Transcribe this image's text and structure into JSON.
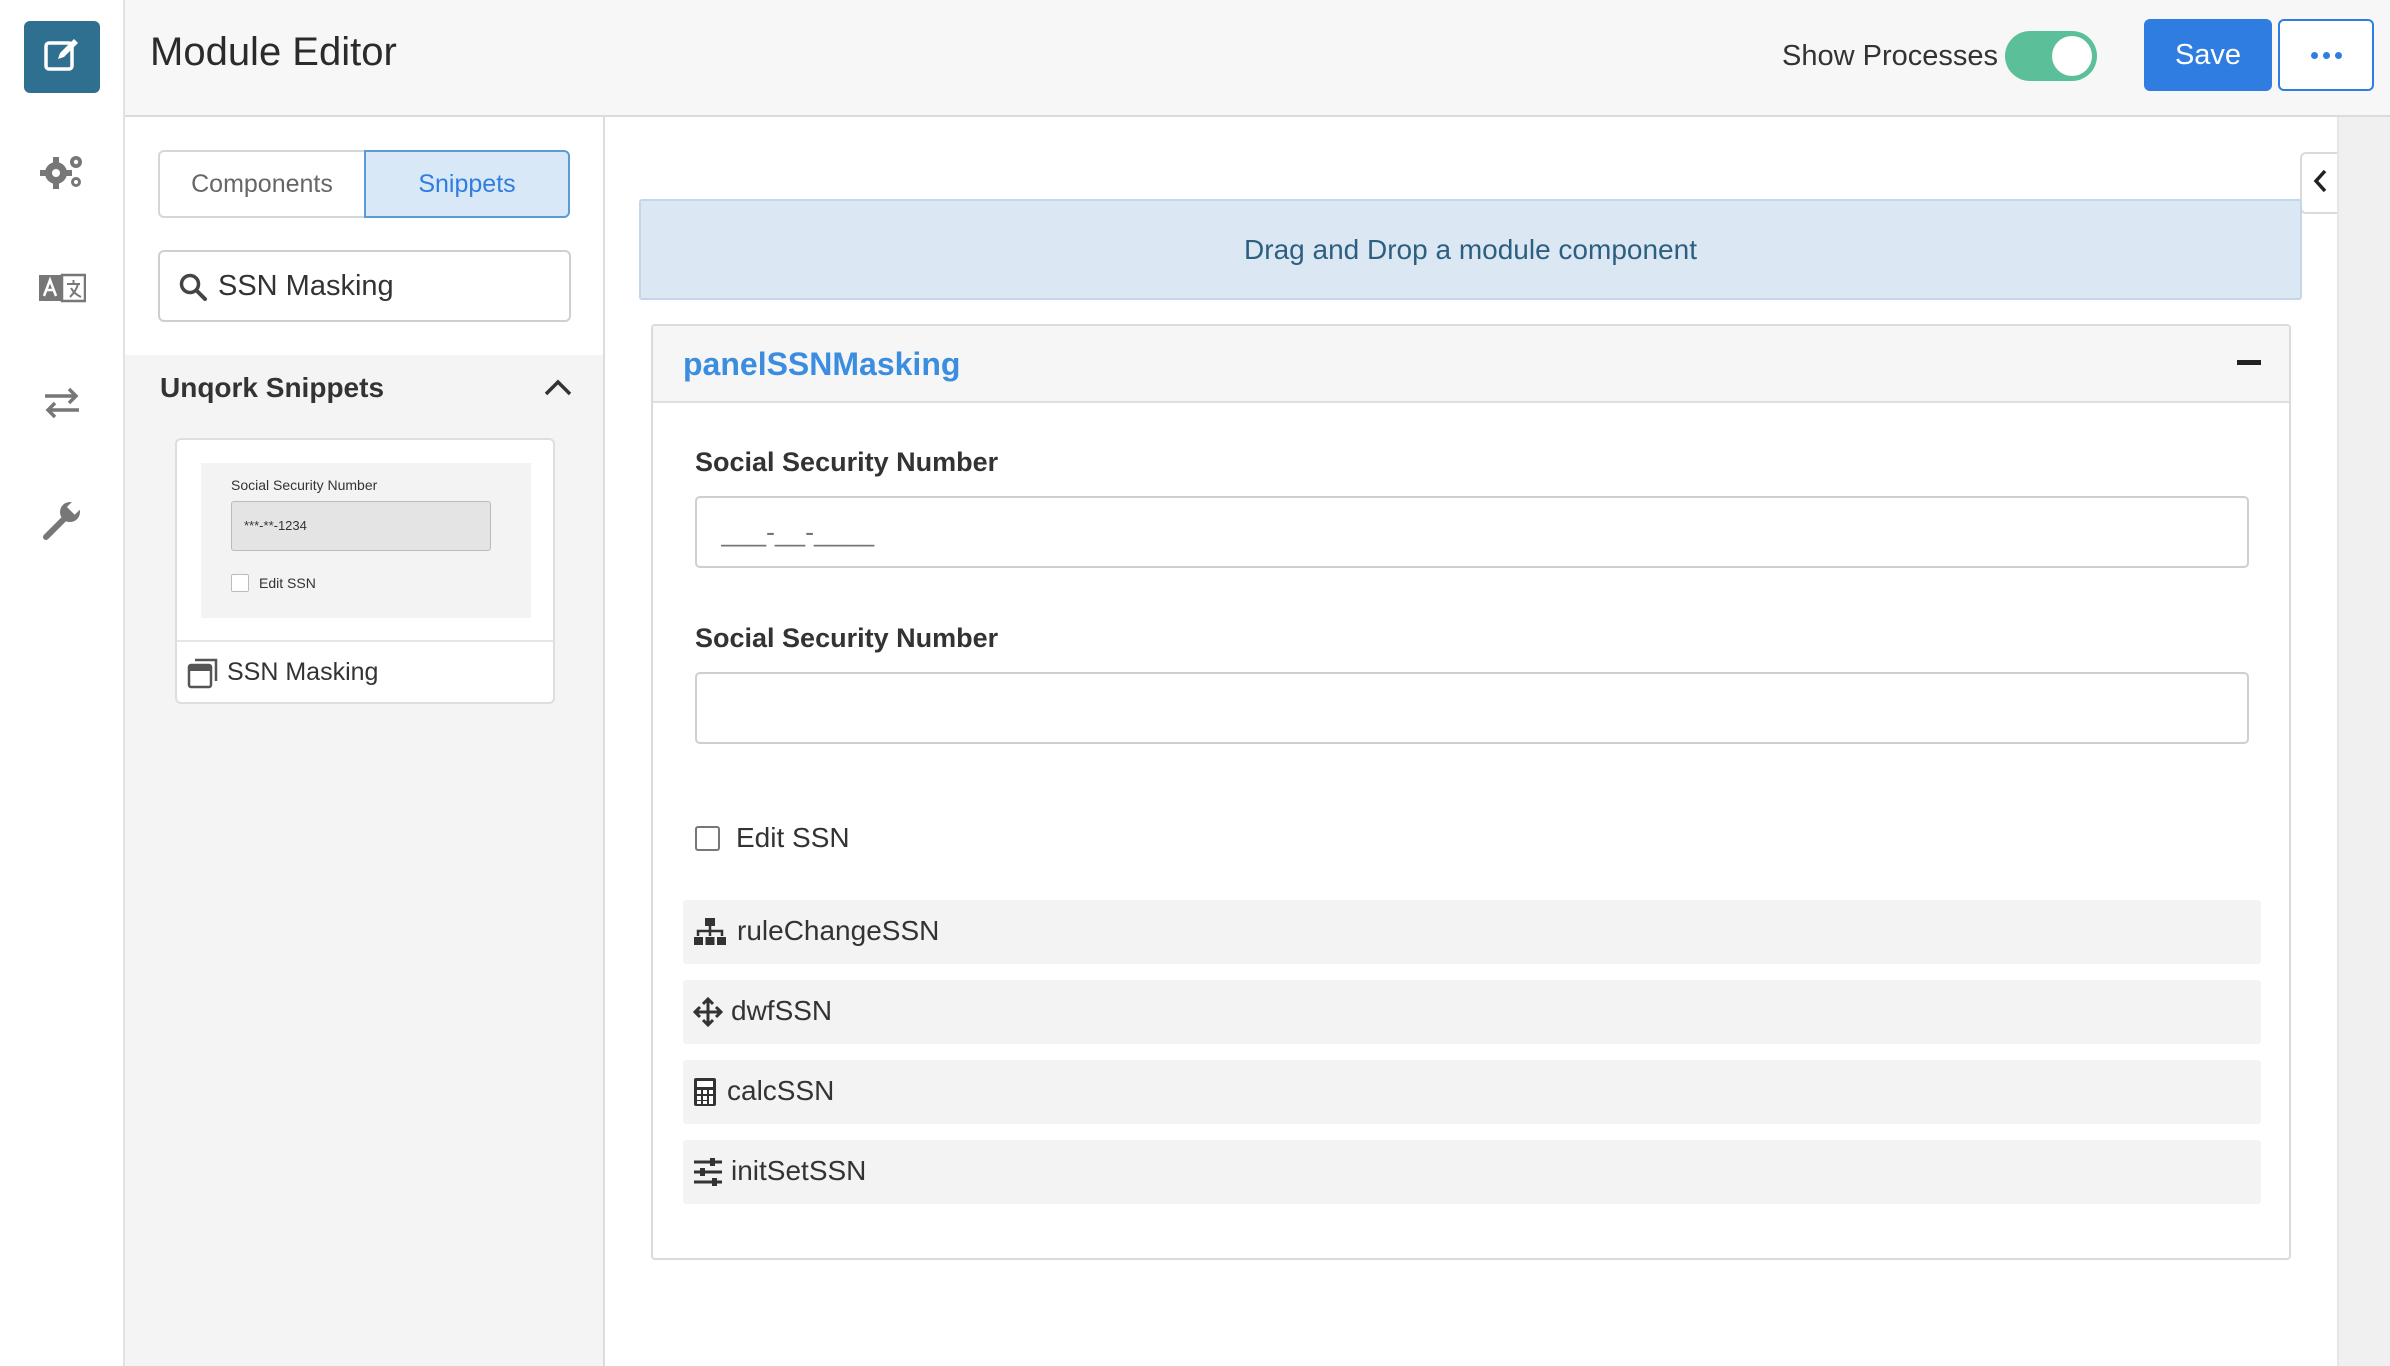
{
  "header": {
    "title": "Module Editor",
    "show_processes_label": "Show Processes",
    "show_processes_on": true,
    "save_label": "Save"
  },
  "rail": {
    "items": [
      "edit-icon",
      "settings-gears-icon",
      "translate-icon",
      "transfer-arrows-icon",
      "wrench-icon"
    ]
  },
  "left_panel": {
    "tabs": [
      {
        "label": "Components",
        "active": false
      },
      {
        "label": "Snippets",
        "active": true
      }
    ],
    "search": {
      "value": "SSN Masking",
      "placeholder": ""
    },
    "section": {
      "title": "Unqork Snippets",
      "expanded": true
    },
    "snippet": {
      "name": "SSN Masking",
      "preview": {
        "field_label": "Social Security Number",
        "field_value": "***-**-1234",
        "checkbox_label": "Edit SSN"
      }
    }
  },
  "canvas": {
    "dropzone_text": "Drag and Drop a module component",
    "panel": {
      "title": "panelSSNMasking",
      "fields": [
        {
          "label": "Social Security Number",
          "value": "",
          "placeholder": "___-__-____"
        },
        {
          "label": "Social Security Number",
          "value": "",
          "placeholder": ""
        }
      ],
      "checkbox": {
        "label": "Edit SSN",
        "checked": false
      },
      "processes": [
        {
          "icon": "sitemap-icon",
          "label": "ruleChangeSSN"
        },
        {
          "icon": "move-arrows-icon",
          "label": "dwfSSN"
        },
        {
          "icon": "calculator-icon",
          "label": "calcSSN"
        },
        {
          "icon": "sliders-icon",
          "label": "initSetSSN"
        }
      ]
    }
  },
  "colors": {
    "rail_active": "#2f6f8f",
    "primary": "#2f7de1",
    "toggle_on": "#5bbf9a",
    "panel_title": "#3b8de0",
    "dropzone_bg": "#dbe8f4"
  }
}
